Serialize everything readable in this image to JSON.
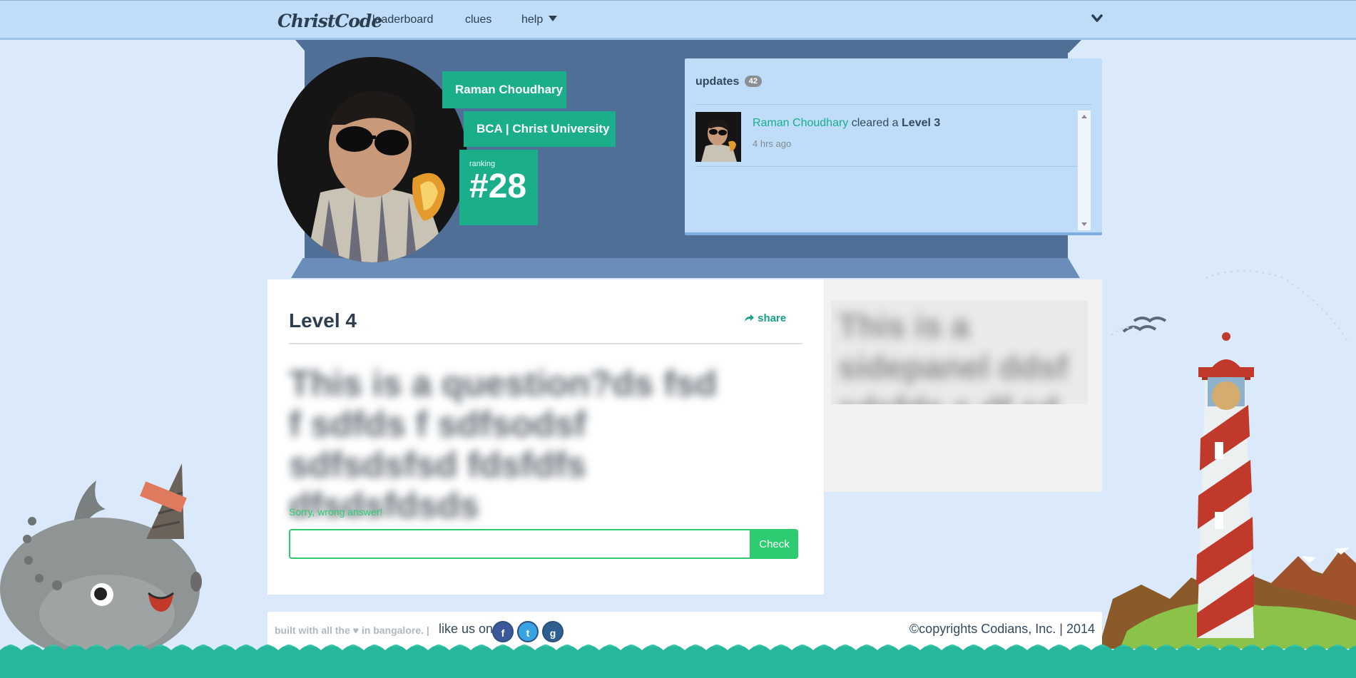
{
  "nav": {
    "brand": "ChristCode",
    "links": [
      "leaderboard",
      "clues",
      "help"
    ]
  },
  "profile": {
    "name": "Raman Choudhary",
    "school": "BCA | Christ University",
    "ranking_label": "ranking",
    "ranking_value": "#28"
  },
  "updates": {
    "title": "updates",
    "count": "42",
    "items": [
      {
        "user": "Raman Choudhary",
        "action": "cleared a",
        "level": "Level 3",
        "time": "4 hrs ago"
      }
    ]
  },
  "level": {
    "title": "Level 4",
    "share_label": "share",
    "question": "This is a question?ds fsd f sdfds f sdfsodsf sdfsdsfsd fdsfdfs dfsdsfdsds",
    "feedback": "Sorry, wrong answer!",
    "answer_value": "",
    "check_label": "Check"
  },
  "side_panel": {
    "text": "This is a sidepanel ddsf sdsfds s df sd"
  },
  "footer": {
    "built_prefix": "built with all the",
    "built_suffix": "in bangalore. |",
    "like_text": "like us on",
    "social": [
      "f",
      "t",
      "g"
    ],
    "copyright": "©copyrights Codians, Inc. | 2014"
  },
  "colors": {
    "accent": "#1aaf8a",
    "success": "#2ecc71",
    "header": "#4f6f96",
    "nav": "#bfdcf8"
  }
}
